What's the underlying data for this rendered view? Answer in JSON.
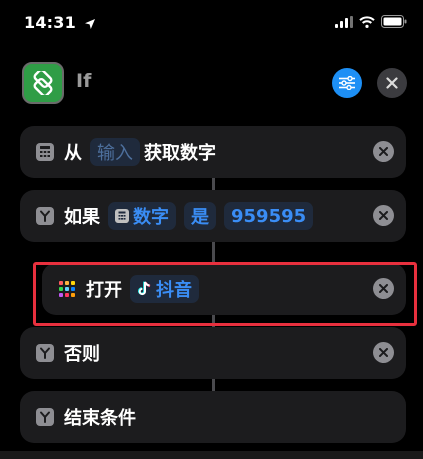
{
  "status_bar": {
    "time": "14:31"
  },
  "header": {
    "title": "If"
  },
  "actions": [
    {
      "id": "get-numbers",
      "label": "从",
      "var_placeholder": "输入",
      "suffix": "获取数字"
    },
    {
      "id": "if",
      "label": "如果",
      "var": "数字",
      "operator": "是",
      "value": "959595"
    },
    {
      "id": "open-app",
      "label": "打开",
      "app": "抖音"
    },
    {
      "id": "otherwise",
      "label": "否则"
    },
    {
      "id": "end-if",
      "label": "结束条件"
    }
  ],
  "colors": {
    "accent": "#1d8ff5",
    "app_icon_green": "#2f9d46",
    "highlight_red": "#e8303e",
    "card_bg": "#1c1c1e"
  },
  "icons": {
    "app": "shortcuts-icon",
    "settings": "sliders-icon",
    "close": "close-icon",
    "calculator": "calculator-icon",
    "branch": "branch-icon",
    "apps_grid": "app-grid-icon",
    "tiktok": "tiktok-icon",
    "remove": "remove-icon"
  }
}
